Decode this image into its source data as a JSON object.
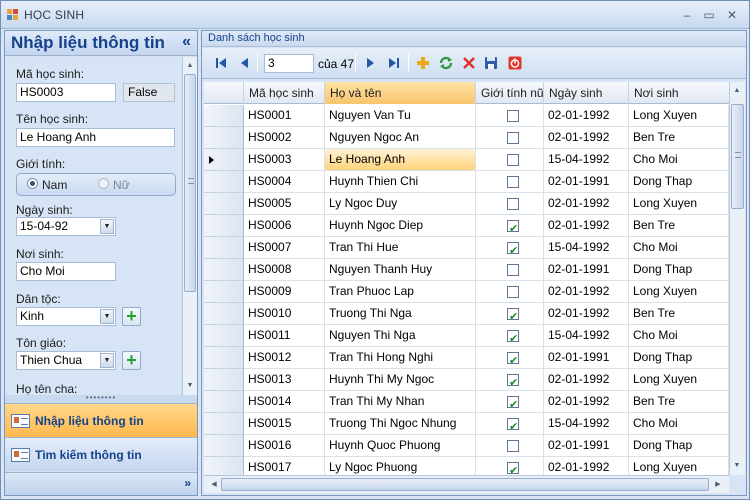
{
  "window": {
    "title": "HỌC SINH"
  },
  "left_panel": {
    "header": "Nhập liệu thông tin",
    "collapse_glyph": "«",
    "fields": {
      "ma_label": "Mã học sinh:",
      "ma_value": "HS0003",
      "gender_flag": "False",
      "ten_label": "Tên học sinh:",
      "ten_value": "Le Hoang Anh",
      "gioitinh_label": "Giới tính:",
      "nam_label": "Nam",
      "nu_label": "Nữ",
      "ngaysinh_label": "Ngày sinh:",
      "ngaysinh_value": "15-04-92",
      "noisinh_label": "Nơi sinh:",
      "noisinh_value": "Cho Moi",
      "dantoc_label": "Dân tộc:",
      "dantoc_value": "Kinh",
      "tongiao_label": "Tôn giáo:",
      "tongiao_value": "Thien Chua",
      "hotencha_label": "Họ tên cha:"
    },
    "nav": {
      "active": "Nhập liệu thông tin",
      "other": "Tìm kiếm thông tin",
      "more": "»"
    }
  },
  "right_panel": {
    "header": "Danh sách học sinh",
    "toolbar": {
      "position": "3",
      "of_label": "của 47"
    },
    "columns": [
      "Mã học sinh",
      "Họ và tên",
      "Giới tính nữ",
      "Ngày sinh",
      "Nơi sinh"
    ],
    "rows": [
      {
        "ma": "HS0001",
        "ten": "Nguyen Van Tu",
        "nu": false,
        "ngay": "02-01-1992",
        "noi": "Long Xuyen"
      },
      {
        "ma": "HS0002",
        "ten": "Nguyen Ngoc An",
        "nu": false,
        "ngay": "02-01-1992",
        "noi": "Ben Tre"
      },
      {
        "ma": "HS0003",
        "ten": "Le Hoang Anh",
        "nu": false,
        "ngay": "15-04-1992",
        "noi": "Cho Moi"
      },
      {
        "ma": "HS0004",
        "ten": "Huynh Thien Chi",
        "nu": false,
        "ngay": "02-01-1991",
        "noi": "Dong Thap"
      },
      {
        "ma": "HS0005",
        "ten": "Ly Ngoc Duy",
        "nu": false,
        "ngay": "02-01-1992",
        "noi": "Long Xuyen"
      },
      {
        "ma": "HS0006",
        "ten": "Huynh Ngoc Diep",
        "nu": true,
        "ngay": "02-01-1992",
        "noi": "Ben Tre"
      },
      {
        "ma": "HS0007",
        "ten": "Tran Thi Hue",
        "nu": true,
        "ngay": "15-04-1992",
        "noi": "Cho Moi"
      },
      {
        "ma": "HS0008",
        "ten": "Nguyen Thanh Huy",
        "nu": false,
        "ngay": "02-01-1991",
        "noi": "Dong Thap"
      },
      {
        "ma": "HS0009",
        "ten": "Tran Phuoc Lap",
        "nu": false,
        "ngay": "02-01-1992",
        "noi": "Long Xuyen"
      },
      {
        "ma": "HS0010",
        "ten": "Truong Thi Nga",
        "nu": true,
        "ngay": "02-01-1992",
        "noi": "Ben Tre"
      },
      {
        "ma": "HS0011",
        "ten": "Nguyen Thi Nga",
        "nu": true,
        "ngay": "15-04-1992",
        "noi": "Cho Moi"
      },
      {
        "ma": "HS0012",
        "ten": "Tran Thi Hong Nghi",
        "nu": true,
        "ngay": "02-01-1991",
        "noi": "Dong Thap"
      },
      {
        "ma": "HS0013",
        "ten": "Huynh Thi My Ngoc",
        "nu": true,
        "ngay": "02-01-1992",
        "noi": "Long Xuyen"
      },
      {
        "ma": "HS0014",
        "ten": "Tran Thi My Nhan",
        "nu": true,
        "ngay": "02-01-1992",
        "noi": "Ben Tre"
      },
      {
        "ma": "HS0015",
        "ten": "Truong Thi Ngoc Nhung",
        "nu": true,
        "ngay": "15-04-1992",
        "noi": "Cho Moi"
      },
      {
        "ma": "HS0016",
        "ten": "Huynh Quoc Phuong",
        "nu": false,
        "ngay": "02-01-1991",
        "noi": "Dong Thap"
      },
      {
        "ma": "HS0017",
        "ten": "Ly Ngoc Phuong",
        "nu": true,
        "ngay": "02-01-1992",
        "noi": "Long Xuyen"
      }
    ],
    "current_row": 2
  },
  "colors": {
    "accent": "#15428b",
    "selected_header": "#f8c46a",
    "nav_active": "#ffb84d"
  }
}
